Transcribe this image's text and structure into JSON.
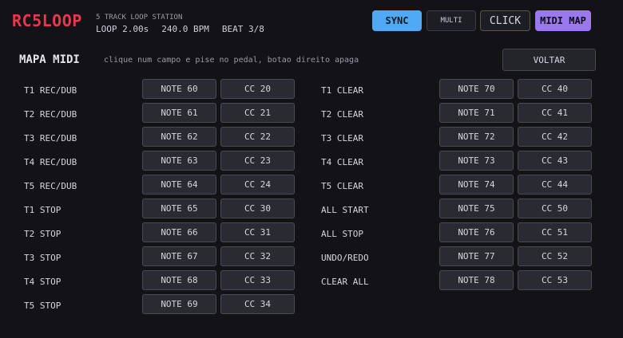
{
  "header": {
    "logo": "RC5LOOP",
    "subtitle": "5 TRACK LOOP STATION",
    "loop": "LOOP 2.00s",
    "bpm": "240.0 BPM",
    "beat": "BEAT 3/8",
    "buttons": {
      "sync": "SYNC",
      "multi": "MULTI",
      "click": "CLICK",
      "midi_map": "MIDI MAP"
    }
  },
  "midi_map": {
    "title": "MAPA MIDI",
    "hint": "clique num campo e pise no pedal, botao direito apaga",
    "back_label": "VOLTAR",
    "left": [
      {
        "label": "T1 REC/DUB",
        "note": "NOTE 60",
        "cc": "CC 20"
      },
      {
        "label": "T2 REC/DUB",
        "note": "NOTE 61",
        "cc": "CC 21"
      },
      {
        "label": "T3 REC/DUB",
        "note": "NOTE 62",
        "cc": "CC 22"
      },
      {
        "label": "T4 REC/DUB",
        "note": "NOTE 63",
        "cc": "CC 23"
      },
      {
        "label": "T5 REC/DUB",
        "note": "NOTE 64",
        "cc": "CC 24"
      },
      {
        "label": "T1 STOP",
        "note": "NOTE 65",
        "cc": "CC 30"
      },
      {
        "label": "T2 STOP",
        "note": "NOTE 66",
        "cc": "CC 31"
      },
      {
        "label": "T3 STOP",
        "note": "NOTE 67",
        "cc": "CC 32"
      },
      {
        "label": "T4 STOP",
        "note": "NOTE 68",
        "cc": "CC 33"
      },
      {
        "label": "T5 STOP",
        "note": "NOTE 69",
        "cc": "CC 34"
      }
    ],
    "right": [
      {
        "label": "T1 CLEAR",
        "note": "NOTE 70",
        "cc": "CC 40"
      },
      {
        "label": "T2 CLEAR",
        "note": "NOTE 71",
        "cc": "CC 41"
      },
      {
        "label": "T3 CLEAR",
        "note": "NOTE 72",
        "cc": "CC 42"
      },
      {
        "label": "T4 CLEAR",
        "note": "NOTE 73",
        "cc": "CC 43"
      },
      {
        "label": "T5 CLEAR",
        "note": "NOTE 74",
        "cc": "CC 44"
      },
      {
        "label": "ALL START",
        "note": "NOTE 75",
        "cc": "CC 50"
      },
      {
        "label": "ALL STOP",
        "note": "NOTE 76",
        "cc": "CC 51"
      },
      {
        "label": "UNDO/REDO",
        "note": "NOTE 77",
        "cc": "CC 52"
      },
      {
        "label": "CLEAR ALL",
        "note": "NOTE 78",
        "cc": "CC 53"
      }
    ]
  },
  "colors": {
    "background": "#121217",
    "logo": "#e8384d",
    "sync_active": "#4fa9f5",
    "midi_map_active": "#9a79f0"
  }
}
